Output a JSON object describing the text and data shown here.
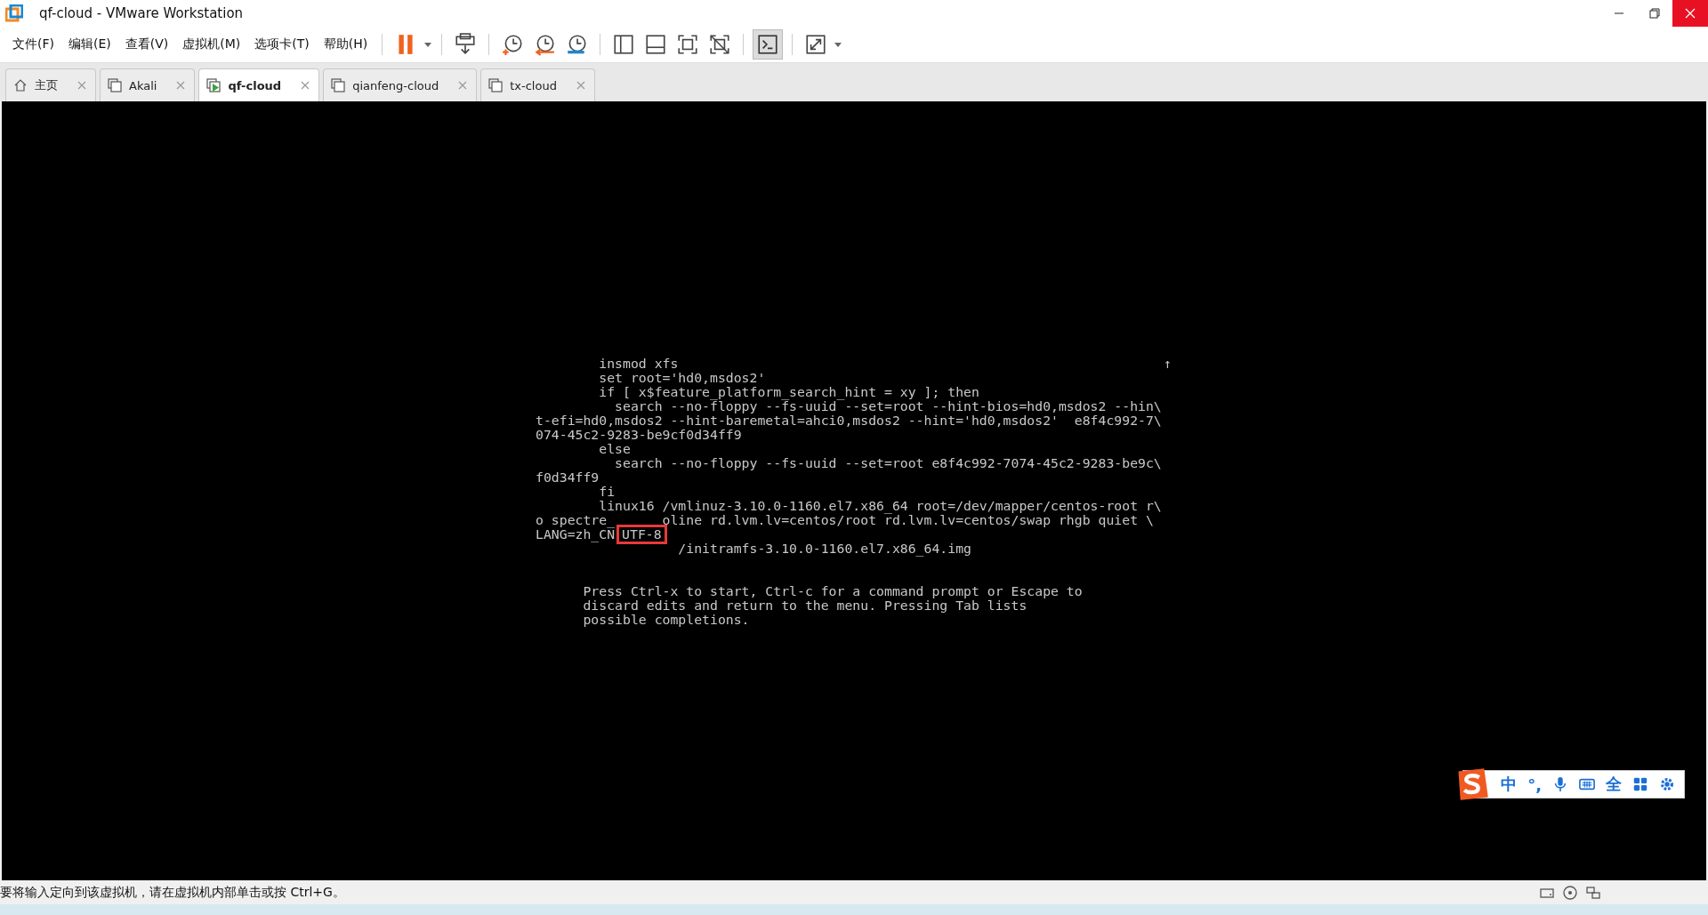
{
  "window": {
    "title": "qf-cloud - VMware Workstation"
  },
  "menu": [
    "文件(F)",
    "编辑(E)",
    "查看(V)",
    "虚拟机(M)",
    "选项卡(T)",
    "帮助(H)"
  ],
  "tabs": [
    {
      "label": "主页",
      "kind": "home",
      "selected": false
    },
    {
      "label": "Akali",
      "kind": "vm",
      "selected": false
    },
    {
      "label": "qf-cloud",
      "kind": "running_vm",
      "selected": true
    },
    {
      "label": "qianfeng-cloud",
      "kind": "vm",
      "selected": false
    },
    {
      "label": "tx-cloud",
      "kind": "vm",
      "selected": false
    }
  ],
  "console": {
    "scroll_indicator": "↑",
    "lines": [
      "        insmod xfs",
      "        set root='hd0,msdos2'",
      "        if [ x$feature_platform_search_hint = xy ]; then",
      "          search --no-floppy --fs-uuid --set=root --hint-bios=hd0,msdos2 --hin\\",
      "t-efi=hd0,msdos2 --hint-baremetal=ahci0,msdos2 --hint='hd0,msdos2'  e8f4c992-7\\",
      "074-45c2-9283-be9cf0d34ff9",
      "        else",
      "          search --no-floppy --fs-uuid --set=root e8f4c992-7074-45c2-9283-be9c\\",
      "f0d34ff9",
      "        fi",
      "        linux16 /vmlinuz-3.10.0-1160.el7.x86_64 root=/dev/mapper/centos-root r\\",
      "o spectre_      oline rd.lvm.lv=centos/root rd.lvm.lv=centos/swap rhgb quiet \\",
      "LANG=zh_CN",
      "                  /initramfs-3.10.0-1160.el7.x86_64.img"
    ],
    "highlight": "UTF-8",
    "help": [
      "      Press Ctrl-x to start, Ctrl-c for a command prompt or Escape to",
      "      discard edits and return to the menu. Pressing Tab lists",
      "      possible completions."
    ]
  },
  "ime_bar": {
    "mode": "中",
    "punctuation": "°,",
    "width": "全"
  },
  "status_bar": {
    "message": "要将输入定向到该虚拟机，请在虚拟机内部单击或按 Ctrl+G。"
  }
}
